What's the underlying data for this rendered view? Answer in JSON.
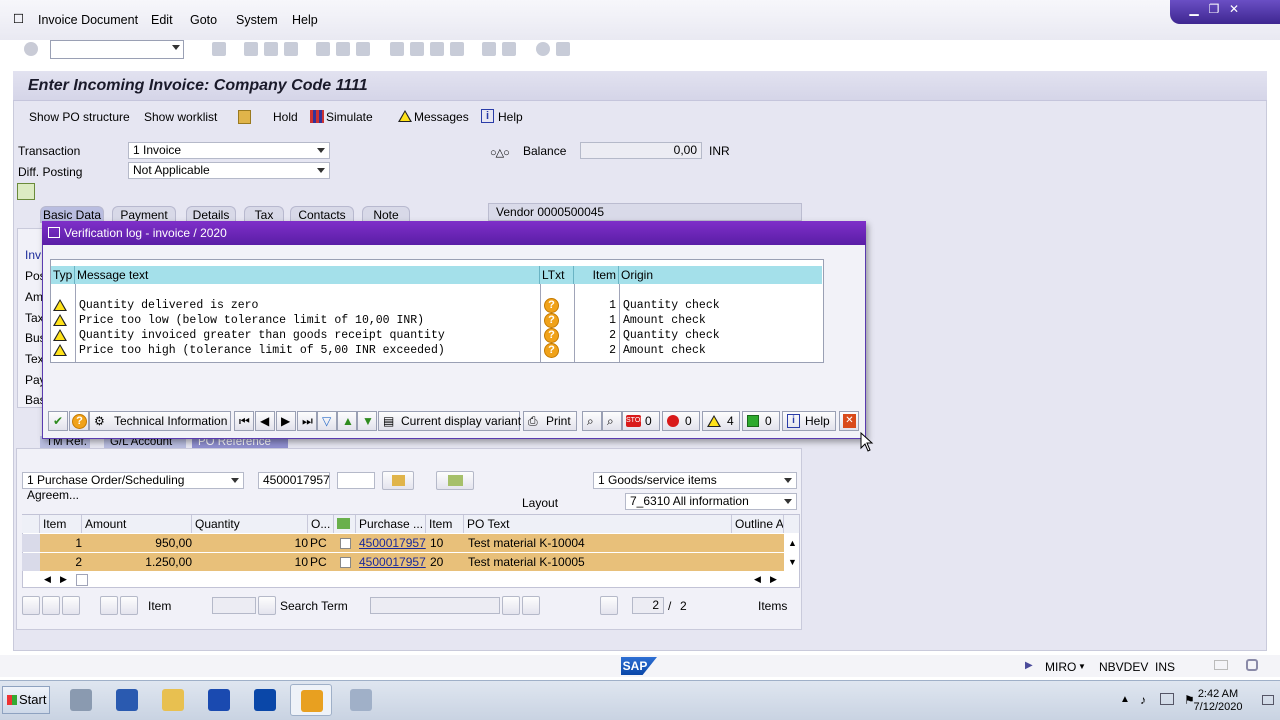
{
  "menubar": {
    "items": [
      "Invoice Document",
      "Edit",
      "Goto",
      "System",
      "Help"
    ]
  },
  "window": {
    "minimize": "▁",
    "restore": "❐",
    "close": "✕"
  },
  "main": {
    "title": "Enter Incoming Invoice: Company Code 1111",
    "app_toolbar": {
      "show_po_structure": "Show PO structure",
      "show_worklist": "Show worklist",
      "hold": "Hold",
      "simulate": "Simulate",
      "messages": "Messages",
      "help": "Help"
    },
    "transaction_label": "Transaction",
    "transaction_value": "1 Invoice",
    "diff_posting_label": "Diff. Posting",
    "diff_posting_value": "Not Applicable",
    "balance_label": "Balance",
    "balance_value": "0,00",
    "balance_currency": "INR",
    "tabs": [
      "Basic Data",
      "Payment",
      "Details",
      "Tax",
      "Contacts",
      "Note"
    ],
    "vendor": "Vendor 0000500045",
    "side_labels": [
      "Inv",
      "Pos",
      "Am",
      "Tax",
      "Bus",
      "Tex",
      "Pay",
      "Bas"
    ],
    "lower_tabs": [
      "TM Ref.",
      "G/L Account",
      "PO Reference"
    ],
    "po_ref_type": "1 Purchase Order/Scheduling Agreem...",
    "po_number": "4500017957",
    "goods_service": "1 Goods/service items",
    "layout_label": "Layout",
    "layout_value": "7_6310 All information",
    "grid": {
      "headers": [
        "Item",
        "Amount",
        "Quantity",
        "O...",
        "",
        "Purchase ...",
        "Item",
        "PO Text",
        "Outline A"
      ],
      "rows": [
        {
          "item": "1",
          "amount": "950,00",
          "quantity": "10",
          "unit": "PC",
          "po": "4500017957",
          "po_item": "10",
          "text": "Test material K-10004"
        },
        {
          "item": "2",
          "amount": "1.250,00",
          "quantity": "10",
          "unit": "PC",
          "po": "4500017957",
          "po_item": "20",
          "text": "Test material K-10005"
        }
      ]
    },
    "bottom": {
      "item_label": "Item",
      "search_term_label": "Search Term",
      "page_current": "2",
      "page_sep": "/",
      "page_total": "2",
      "items_label": "Items"
    }
  },
  "dialog": {
    "title": "Verification log - invoice  / 2020",
    "headers": {
      "typ": "Typ",
      "message": "Message text",
      "ltxt": "LTxt",
      "item": "Item",
      "origin": "Origin"
    },
    "rows": [
      {
        "message": "Quantity delivered is zero",
        "item": "1",
        "origin": "Quantity check"
      },
      {
        "message": "Price too low (below tolerance limit of 10,00 INR)",
        "item": "1",
        "origin": "Amount check"
      },
      {
        "message": "Quantity invoiced greater than goods receipt quantity",
        "item": "2",
        "origin": "Quantity check"
      },
      {
        "message": "Price too high (tolerance limit of 5,00 INR exceeded)",
        "item": "2",
        "origin": "Amount check"
      }
    ],
    "toolbar": {
      "technical_information": "Technical Information",
      "current_display_variant": "Current display variant",
      "print": "Print",
      "stop_count": "0",
      "error_count": "0",
      "warning_count": "4",
      "success_count": "0",
      "help": "Help"
    }
  },
  "statusbar": {
    "logo": "SAP",
    "transaction": "MIRO",
    "system": "NBVDEV",
    "mode": "INS"
  },
  "taskbar": {
    "start": "Start",
    "time": "2:42 AM",
    "date": "7/12/2020"
  },
  "colors": {
    "dialog_title": "#6a25b8",
    "table_header": "#a4e0ea",
    "grid_row": "#e8c07a",
    "warning": "#ffe21a"
  }
}
